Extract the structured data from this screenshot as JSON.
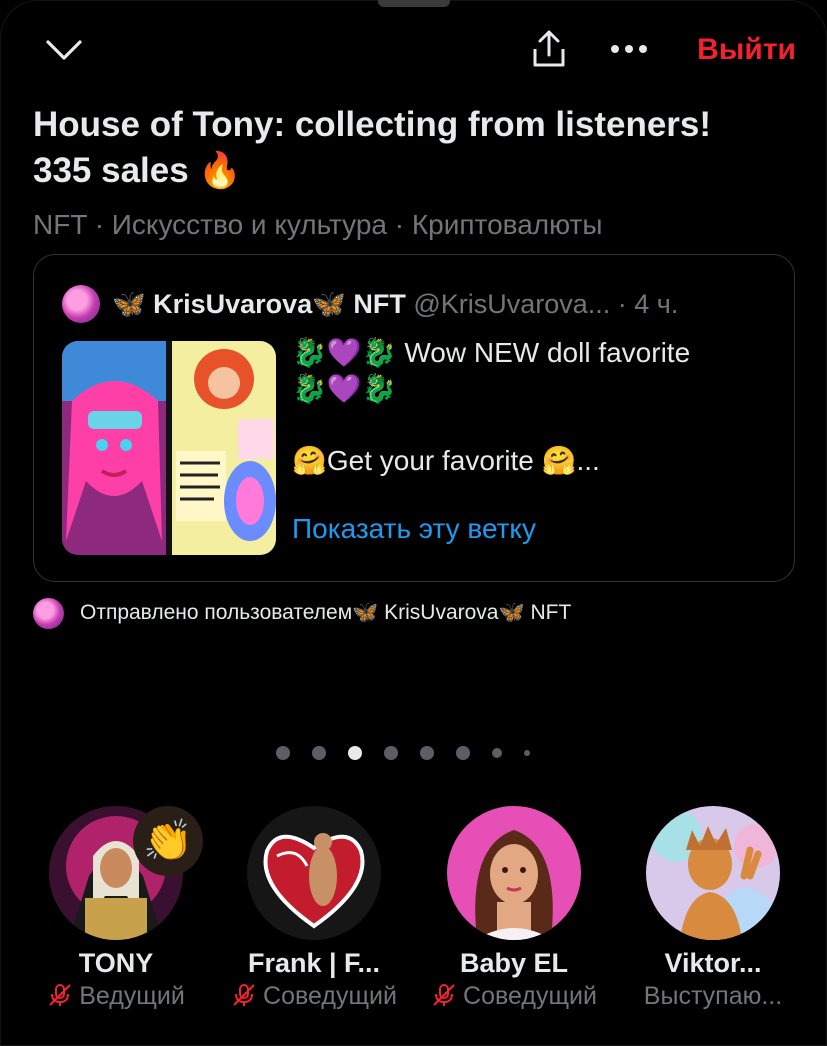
{
  "header": {
    "leave_label": "Выйти"
  },
  "space": {
    "title_line1": "House of Tony: collecting from listeners!",
    "title_line2": "335 sales 🔥",
    "topics": "NFT · Искусство и культура · Криптовалюты"
  },
  "tweet": {
    "name_prefix": "🦋 KrisUvarova",
    "name_suffix": " NFT ",
    "handle": "@KrisUvarova...",
    "time": " · 4 ч.",
    "line1": "🐉💜🐉 Wow NEW doll favorite",
    "line2": "🐉💜🐉",
    "line3": "🤗Get your favorite 🤗...",
    "show_thread": "Показать эту ветку"
  },
  "posted_by": {
    "prefix": "Отправлено пользователем ",
    "user_prefix": "🦋 KrisUvarova",
    "user_suffix": " NFT"
  },
  "pager": {
    "total": 8,
    "active_index": 2
  },
  "speakers": [
    {
      "name": "TONY",
      "role": "Ведущий"
    },
    {
      "name": "Frank | F...",
      "role": "Соведущий"
    },
    {
      "name": "Baby EL",
      "role": "Соведущий"
    },
    {
      "name": "Viktor...",
      "role": "Выступаю..."
    }
  ],
  "colors": {
    "leave": "#f4212e",
    "link": "#1d9bf0",
    "muted_mic": "#f4212e",
    "secondary_text": "#71767b"
  },
  "icons": {
    "back": "chevron-down-icon",
    "share": "share-icon",
    "more": "more-horizontal-icon",
    "mic_off": "mic-off-icon",
    "clap": "clapping-hands-emoji"
  }
}
